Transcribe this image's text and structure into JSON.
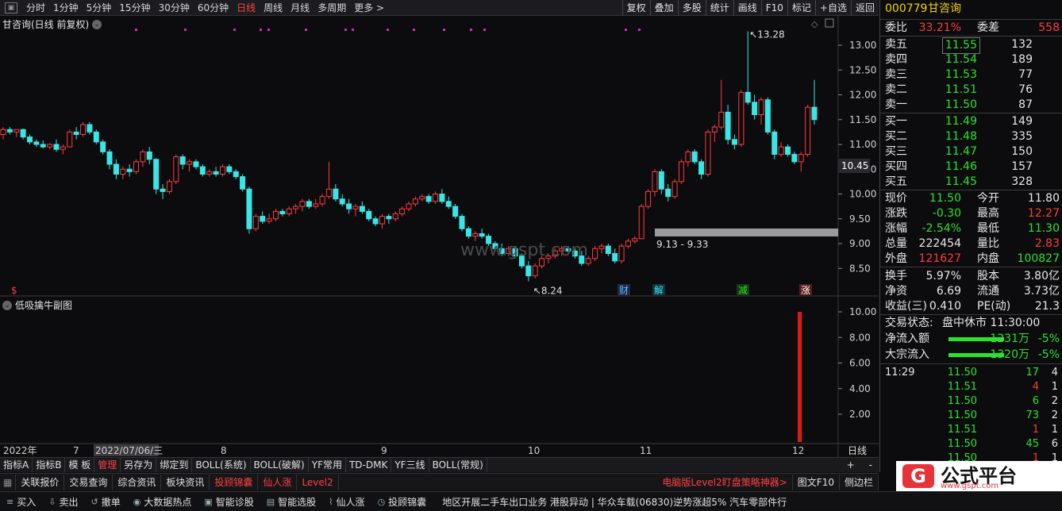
{
  "toolbar": {
    "periods": [
      "分时",
      "1分钟",
      "5分钟",
      "15分钟",
      "30分钟",
      "60分钟",
      "日线",
      "周线",
      "月线",
      "多周期",
      "更多 >"
    ],
    "active_period": "日线",
    "right_tools": [
      "复权",
      "叠加",
      "多股",
      "统计",
      "画线",
      "F10",
      "标记",
      "+自选",
      "返回"
    ]
  },
  "chart": {
    "title": "甘咨询(日线 前复权)",
    "price_ticks": [
      "13.00",
      "12.50",
      "12.00",
      "11.50",
      "11.00",
      "10.50",
      "10.00",
      "9.50",
      "9.00",
      "8.50"
    ],
    "current_price_tag": "10.45",
    "high_label": "13.28",
    "low_label": "8.24",
    "range_label": "9.13 - 9.33",
    "markers": [
      "$",
      "财",
      "解",
      "减",
      "涨"
    ],
    "watermark": "www.gspt.com",
    "sub_title": "低吸擒牛副图",
    "sub_ticks": [
      "10.00",
      "8.00",
      "6.00",
      "4.00",
      "2.00"
    ],
    "x_labels": [
      "2022年",
      "7",
      "2022/07/06/三",
      "8",
      "9",
      "10",
      "11",
      "12"
    ],
    "period_tag": "日线"
  },
  "chart_data": {
    "type": "candlestick",
    "ylim": [
      8.0,
      13.5
    ],
    "candles": [
      [
        11.2,
        11.35,
        11.1,
        11.3
      ],
      [
        11.3,
        11.35,
        11.2,
        11.25
      ],
      [
        11.25,
        11.3,
        11.15,
        11.3
      ],
      [
        11.3,
        11.32,
        11.1,
        11.15
      ],
      [
        11.15,
        11.2,
        11.0,
        11.05
      ],
      [
        11.05,
        11.1,
        10.95,
        11.0
      ],
      [
        11.0,
        11.08,
        10.92,
        10.95
      ],
      [
        10.95,
        11.02,
        10.9,
        11.0
      ],
      [
        11.0,
        11.1,
        10.85,
        10.9
      ],
      [
        10.9,
        11.0,
        10.8,
        10.95
      ],
      [
        10.95,
        11.3,
        10.95,
        11.25
      ],
      [
        11.25,
        11.35,
        11.1,
        11.2
      ],
      [
        11.2,
        11.45,
        11.15,
        11.4
      ],
      [
        11.4,
        11.45,
        11.2,
        11.25
      ],
      [
        11.25,
        11.3,
        11.0,
        11.05
      ],
      [
        11.05,
        11.1,
        10.8,
        10.85
      ],
      [
        10.85,
        10.9,
        10.5,
        10.6
      ],
      [
        10.6,
        10.7,
        10.3,
        10.4
      ],
      [
        10.4,
        10.55,
        10.3,
        10.5
      ],
      [
        10.5,
        10.6,
        10.35,
        10.45
      ],
      [
        10.45,
        10.7,
        10.4,
        10.65
      ],
      [
        10.65,
        10.9,
        10.55,
        10.85
      ],
      [
        10.85,
        10.95,
        10.6,
        10.7
      ],
      [
        10.7,
        10.72,
        10.0,
        10.1
      ],
      [
        10.1,
        10.2,
        9.9,
        10.05
      ],
      [
        10.05,
        10.3,
        10.0,
        10.25
      ],
      [
        10.25,
        10.8,
        10.2,
        10.75
      ],
      [
        10.75,
        10.8,
        10.5,
        10.6
      ],
      [
        10.6,
        10.7,
        10.45,
        10.65
      ],
      [
        10.65,
        10.7,
        10.5,
        10.55
      ],
      [
        10.55,
        10.6,
        10.35,
        10.4
      ],
      [
        10.4,
        10.5,
        10.35,
        10.45
      ],
      [
        10.45,
        10.55,
        10.35,
        10.4
      ],
      [
        10.4,
        10.6,
        10.35,
        10.55
      ],
      [
        10.55,
        10.6,
        10.4,
        10.45
      ],
      [
        10.45,
        10.5,
        10.3,
        10.35
      ],
      [
        10.35,
        10.4,
        10.05,
        10.1
      ],
      [
        10.1,
        10.15,
        9.2,
        9.3
      ],
      [
        9.3,
        9.6,
        9.25,
        9.55
      ],
      [
        9.55,
        9.65,
        9.4,
        9.45
      ],
      [
        9.45,
        9.6,
        9.4,
        9.5
      ],
      [
        9.5,
        9.7,
        9.45,
        9.65
      ],
      [
        9.65,
        9.7,
        9.55,
        9.6
      ],
      [
        9.6,
        9.75,
        9.55,
        9.7
      ],
      [
        9.7,
        9.8,
        9.6,
        9.75
      ],
      [
        9.75,
        9.9,
        9.65,
        9.85
      ],
      [
        9.85,
        9.9,
        9.7,
        9.75
      ],
      [
        9.75,
        9.9,
        9.7,
        9.8
      ],
      [
        9.8,
        10.0,
        9.75,
        9.95
      ],
      [
        9.95,
        10.65,
        9.9,
        10.1
      ],
      [
        10.1,
        10.2,
        9.85,
        9.9
      ],
      [
        9.9,
        10.0,
        9.75,
        9.8
      ],
      [
        9.8,
        9.9,
        9.6,
        9.7
      ],
      [
        9.7,
        9.8,
        9.55,
        9.75
      ],
      [
        9.75,
        9.85,
        9.6,
        9.65
      ],
      [
        9.65,
        9.7,
        9.45,
        9.5
      ],
      [
        9.5,
        9.55,
        9.35,
        9.4
      ],
      [
        9.4,
        9.6,
        9.3,
        9.55
      ],
      [
        9.55,
        9.6,
        9.4,
        9.5
      ],
      [
        9.5,
        9.65,
        9.45,
        9.6
      ],
      [
        9.6,
        9.75,
        9.55,
        9.7
      ],
      [
        9.7,
        9.85,
        9.65,
        9.8
      ],
      [
        9.8,
        9.95,
        9.75,
        9.9
      ],
      [
        9.9,
        10.0,
        9.85,
        9.95
      ],
      [
        9.95,
        10.0,
        9.8,
        9.85
      ],
      [
        9.85,
        10.05,
        9.8,
        10.0
      ],
      [
        10.0,
        10.1,
        9.8,
        9.85
      ],
      [
        9.85,
        9.95,
        9.7,
        9.75
      ],
      [
        9.75,
        9.8,
        9.5,
        9.55
      ],
      [
        9.55,
        9.6,
        9.25,
        9.3
      ],
      [
        9.3,
        9.35,
        9.1,
        9.15
      ],
      [
        9.15,
        9.25,
        9.05,
        9.2
      ],
      [
        9.2,
        9.3,
        9.1,
        9.15
      ],
      [
        9.15,
        9.2,
        8.95,
        9.0
      ],
      [
        9.0,
        9.05,
        8.85,
        8.9
      ],
      [
        8.9,
        9.0,
        8.75,
        8.8
      ],
      [
        8.8,
        8.95,
        8.75,
        8.9
      ],
      [
        8.9,
        8.95,
        8.7,
        8.75
      ],
      [
        8.75,
        8.8,
        8.5,
        8.55
      ],
      [
        8.55,
        8.65,
        8.24,
        8.35
      ],
      [
        8.35,
        8.6,
        8.3,
        8.55
      ],
      [
        8.55,
        8.75,
        8.5,
        8.7
      ],
      [
        8.7,
        8.8,
        8.6,
        8.75
      ],
      [
        8.75,
        8.9,
        8.7,
        8.85
      ],
      [
        8.85,
        8.95,
        8.75,
        8.9
      ],
      [
        8.9,
        8.95,
        8.8,
        8.85
      ],
      [
        8.85,
        8.9,
        8.7,
        8.75
      ],
      [
        8.75,
        8.85,
        8.55,
        8.6
      ],
      [
        8.6,
        8.75,
        8.55,
        8.7
      ],
      [
        8.7,
        8.95,
        8.65,
        8.9
      ],
      [
        8.9,
        9.0,
        8.8,
        8.95
      ],
      [
        8.95,
        9.0,
        8.75,
        8.8
      ],
      [
        8.8,
        8.9,
        8.6,
        8.65
      ],
      [
        8.65,
        9.0,
        8.6,
        8.95
      ],
      [
        8.95,
        9.1,
        8.9,
        9.05
      ],
      [
        9.05,
        9.15,
        9.0,
        9.1
      ],
      [
        9.1,
        9.8,
        9.1,
        9.75
      ],
      [
        9.75,
        10.1,
        9.7,
        10.05
      ],
      [
        10.05,
        10.5,
        9.95,
        10.45
      ],
      [
        10.45,
        10.5,
        10.0,
        10.1
      ],
      [
        10.1,
        10.2,
        9.85,
        9.95
      ],
      [
        9.95,
        10.3,
        9.9,
        10.25
      ],
      [
        10.25,
        10.7,
        10.2,
        10.65
      ],
      [
        10.65,
        10.9,
        10.55,
        10.85
      ],
      [
        10.85,
        10.9,
        10.6,
        10.65
      ],
      [
        10.65,
        10.7,
        10.3,
        10.4
      ],
      [
        10.4,
        11.3,
        10.35,
        11.25
      ],
      [
        11.25,
        11.4,
        11.05,
        11.35
      ],
      [
        11.35,
        12.3,
        11.3,
        11.65
      ],
      [
        11.65,
        11.8,
        11.0,
        11.1
      ],
      [
        11.1,
        11.2,
        10.9,
        11.0
      ],
      [
        11.0,
        12.1,
        10.95,
        12.05
      ],
      [
        12.05,
        13.28,
        11.8,
        11.85
      ],
      [
        11.85,
        12.0,
        11.5,
        11.6
      ],
      [
        11.6,
        11.95,
        11.4,
        11.9
      ],
      [
        11.9,
        11.95,
        11.2,
        11.25
      ],
      [
        11.25,
        11.3,
        10.7,
        10.8
      ],
      [
        10.8,
        11.05,
        10.75,
        10.95
      ],
      [
        10.95,
        11.0,
        10.75,
        10.8
      ],
      [
        10.8,
        10.85,
        10.6,
        10.65
      ],
      [
        10.65,
        10.85,
        10.45,
        10.8
      ],
      [
        10.8,
        11.8,
        10.75,
        11.75
      ],
      [
        11.75,
        12.3,
        11.4,
        11.5
      ]
    ],
    "sub_values": [
      10.0
    ],
    "sub_ylim": [
      0,
      11
    ]
  },
  "quote": {
    "code": "000779",
    "name": "甘咨询",
    "weibi_label": "委比",
    "weibi": "33.21%",
    "weicha_label": "委差",
    "weicha": "558",
    "sells": [
      {
        "label": "卖五",
        "price": "11.55",
        "vol": "132"
      },
      {
        "label": "卖四",
        "price": "11.54",
        "vol": "189"
      },
      {
        "label": "卖三",
        "price": "11.53",
        "vol": "77"
      },
      {
        "label": "卖二",
        "price": "11.51",
        "vol": "76"
      },
      {
        "label": "卖一",
        "price": "11.50",
        "vol": "87"
      }
    ],
    "buys": [
      {
        "label": "买一",
        "price": "11.49",
        "vol": "149"
      },
      {
        "label": "买二",
        "price": "11.48",
        "vol": "335"
      },
      {
        "label": "买三",
        "price": "11.47",
        "vol": "150"
      },
      {
        "label": "买四",
        "price": "11.46",
        "vol": "157"
      },
      {
        "label": "买五",
        "price": "11.45",
        "vol": "328"
      }
    ],
    "stats": [
      {
        "l1": "现价",
        "v1": "11.50",
        "c1": "green",
        "l2": "今开",
        "v2": "11.80",
        "c2": "white"
      },
      {
        "l1": "涨跌",
        "v1": "-0.30",
        "c1": "green",
        "l2": "最高",
        "v2": "12.27",
        "c2": "red"
      },
      {
        "l1": "涨幅",
        "v1": "-2.54%",
        "c1": "green",
        "l2": "最低",
        "v2": "11.30",
        "c2": "green"
      },
      {
        "l1": "总量",
        "v1": "222454",
        "c1": "white",
        "l2": "量比",
        "v2": "2.83",
        "c2": "red"
      },
      {
        "l1": "外盘",
        "v1": "121627",
        "c1": "red",
        "l2": "内盘",
        "v2": "100827",
        "c2": "green"
      },
      {
        "l1": "换手",
        "v1": "5.97%",
        "c1": "white",
        "l2": "股本",
        "v2": "3.80亿",
        "c2": "white"
      },
      {
        "l1": "净资",
        "v1": "6.69",
        "c1": "white",
        "l2": "流通",
        "v2": "3.73亿",
        "c2": "white"
      },
      {
        "l1": "收益(三)",
        "v1": "0.410",
        "c1": "white",
        "l2": "PE(动)",
        "v2": "21.3",
        "c2": "white"
      }
    ],
    "trade_status_label": "交易状态:",
    "trade_status": "盘中休市 11:30:00",
    "netflow_label": "净流入额",
    "netflow": "-1231万",
    "netflow_pct": "-5%",
    "bigflow_label": "大宗流入",
    "bigflow": "-1320万",
    "bigflow_pct": "-5%",
    "ticks": [
      {
        "t": "11:29",
        "p": "11.50",
        "v": "17",
        "n": "4",
        "vc": "green"
      },
      {
        "t": "",
        "p": "11.51",
        "v": "4",
        "n": "1",
        "vc": "red"
      },
      {
        "t": "",
        "p": "11.50",
        "v": "6",
        "n": "2",
        "vc": "green"
      },
      {
        "t": "",
        "p": "11.50",
        "v": "73",
        "n": "2",
        "vc": "green"
      },
      {
        "t": "",
        "p": "11.51",
        "v": "1",
        "n": "1",
        "vc": "red"
      },
      {
        "t": "",
        "p": "11.50",
        "v": "45",
        "n": "6",
        "vc": "green"
      },
      {
        "t": "",
        "p": "11.50",
        "v": "1",
        "n": "1",
        "vc": "red"
      }
    ]
  },
  "indicator_bar": {
    "items": [
      "指标A",
      "指标B",
      "模 板",
      "管理",
      "另存为",
      "绑定到",
      "BOLL(系统)",
      "BOLL(破解)",
      "YF常用",
      "TD-DMK",
      "YF三线",
      "BOLL(常规)"
    ],
    "active": "管理",
    "plus": "+",
    "minus": "-"
  },
  "tab_bar": {
    "items": [
      "关联报价",
      "交易查询",
      "综合资讯",
      "板块资讯",
      "投顾锦囊",
      "仙人涨",
      "Level2"
    ],
    "highlight": [
      "投顾锦囊",
      "仙人涨",
      "Level2"
    ],
    "right": [
      "电脑版Level2盯盘策略神器>",
      "图文F10",
      "侧边栏"
    ]
  },
  "action_bar": {
    "items": [
      {
        "icon": "≡",
        "label": "买入"
      },
      {
        "icon": "⇩",
        "label": "卖出"
      },
      {
        "icon": "↺",
        "label": "撤单"
      },
      {
        "icon": "◉",
        "label": "大数据热点"
      },
      {
        "icon": "▣",
        "label": "智能诊股"
      },
      {
        "icon": "▤",
        "label": "智能选股"
      },
      {
        "icon": "⌇",
        "label": "仙人涨"
      },
      {
        "icon": "◷",
        "label": "投顾锦囊"
      }
    ],
    "ticker": "地区开展二手车出口业务    港股异动 | 华众车载(06830)逆势涨超5% 汽车零部件行"
  },
  "logo": {
    "mark": "G",
    "title": "公式平台",
    "url": "www.gspt.com"
  }
}
